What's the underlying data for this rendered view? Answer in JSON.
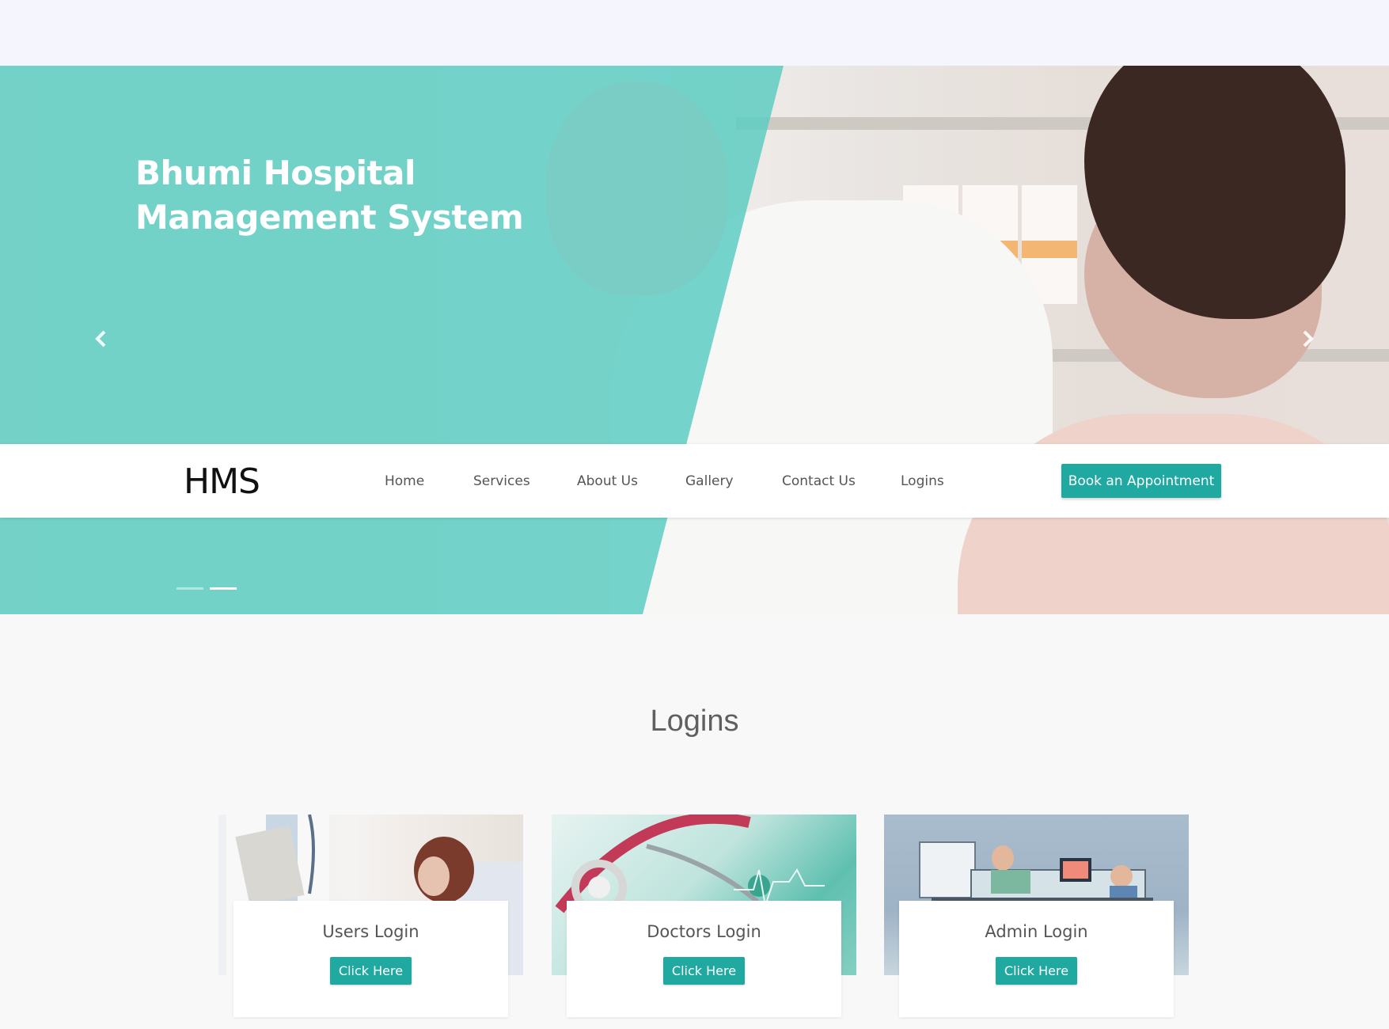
{
  "hero": {
    "title": "Bhumi Hospital Management System",
    "prev_icon": "chevron-left-icon",
    "next_icon": "chevron-right-icon",
    "slide_count": 2,
    "active_slide": 2
  },
  "nav": {
    "logo": "HMS",
    "links": [
      "Home",
      "Services",
      "About Us",
      "Gallery",
      "Contact Us",
      "Logins"
    ],
    "cta": "Book an Appointment"
  },
  "logins": {
    "title": "Logins",
    "cards": [
      {
        "title": "Users Login",
        "button": "Click Here"
      },
      {
        "title": "Doctors Login",
        "button": "Click Here"
      },
      {
        "title": "Admin Login",
        "button": "Click Here"
      }
    ]
  },
  "colors": {
    "accent": "#1fa9a0",
    "hero_overlay": "#5ecdc3",
    "text_dark": "#555555"
  }
}
